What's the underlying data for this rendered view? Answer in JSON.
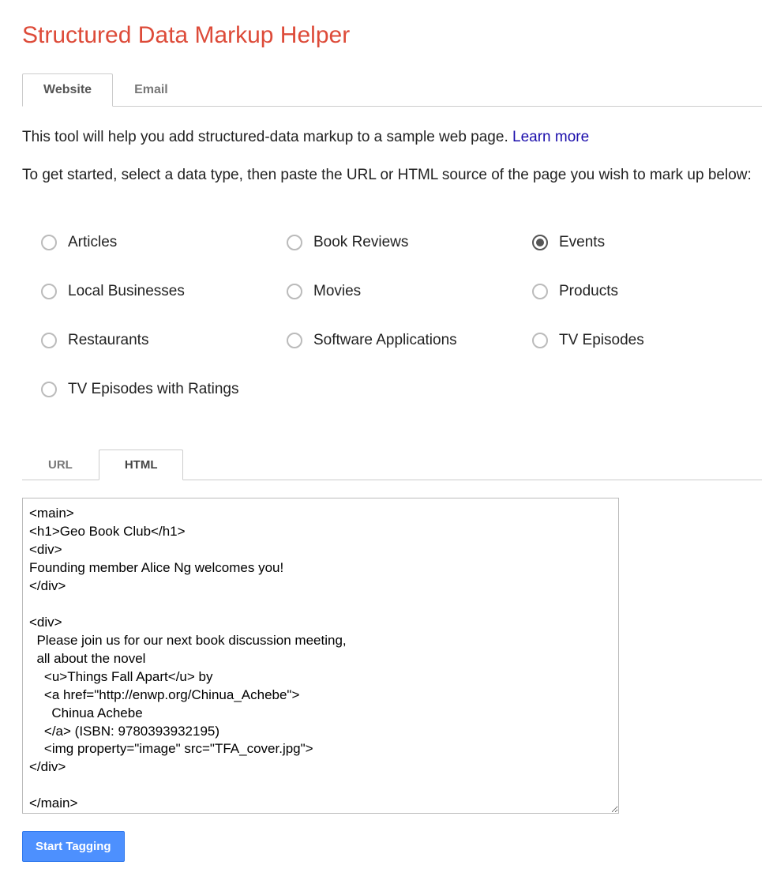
{
  "title": "Structured Data Markup Helper",
  "topTabs": {
    "website": "Website",
    "email": "Email",
    "active": "website"
  },
  "intro": {
    "line1_prefix": "This tool will help you add structured-data markup to a sample web page. ",
    "learn_more": "Learn more",
    "line2": "To get started, select a data type, then paste the URL or HTML source of the page you wish to mark up below:"
  },
  "dataTypes": [
    {
      "id": "articles",
      "label": "Articles",
      "selected": false
    },
    {
      "id": "book-reviews",
      "label": "Book Reviews",
      "selected": false
    },
    {
      "id": "events",
      "label": "Events",
      "selected": true
    },
    {
      "id": "local-businesses",
      "label": "Local Businesses",
      "selected": false
    },
    {
      "id": "movies",
      "label": "Movies",
      "selected": false
    },
    {
      "id": "products",
      "label": "Products",
      "selected": false
    },
    {
      "id": "restaurants",
      "label": "Restaurants",
      "selected": false
    },
    {
      "id": "software-applications",
      "label": "Software Applications",
      "selected": false
    },
    {
      "id": "tv-episodes",
      "label": "TV Episodes",
      "selected": false
    },
    {
      "id": "tv-episodes-ratings",
      "label": "TV Episodes with Ratings",
      "selected": false
    }
  ],
  "sourceTabs": {
    "url": "URL",
    "html": "HTML",
    "active": "html"
  },
  "htmlSource": "<main>\n<h1>Geo Book Club</h1>\n<div>\nFounding member Alice Ng welcomes you!\n</div>\n\n<div>\n  Please join us for our next book discussion meeting,\n  all about the novel\n    <u>Things Fall Apart</u> by\n    <a href=\"http://enwp.org/Chinua_Achebe\">\n      Chinua Achebe\n    </a> (ISBN: 9780393932195)\n    <img property=\"image\" src=\"TFA_cover.jpg\">\n</div>\n\n</main>",
  "buttons": {
    "start_tagging": "Start Tagging"
  }
}
